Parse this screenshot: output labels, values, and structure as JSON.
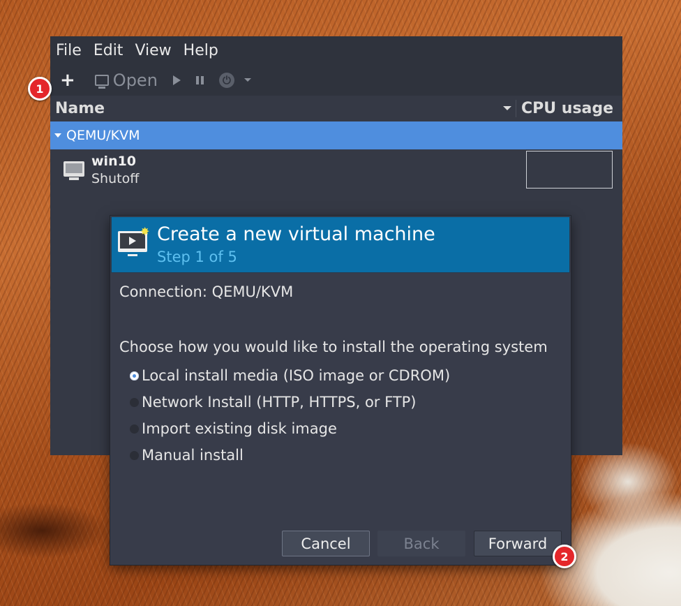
{
  "menubar": {
    "items": [
      "File",
      "Edit",
      "View",
      "Help"
    ]
  },
  "toolbar": {
    "new_label": "+",
    "open_label": "Open"
  },
  "columns": {
    "name": "Name",
    "cpu": "CPU usage"
  },
  "vm_list": {
    "group": "QEMU/KVM",
    "vms": [
      {
        "name": "win10",
        "state": "Shutoff"
      }
    ]
  },
  "dialog": {
    "title": "Create a new virtual machine",
    "step": "Step 1 of 5",
    "connection": "Connection: QEMU/KVM",
    "prompt": "Choose how you would like to install the operating system",
    "options": [
      {
        "label": "Local install media (ISO image or CDROM)",
        "selected": true
      },
      {
        "label": "Network Install (HTTP, HTTPS, or FTP)",
        "selected": false
      },
      {
        "label": "Import existing disk image",
        "selected": false
      },
      {
        "label": "Manual install",
        "selected": false
      }
    ],
    "buttons": {
      "cancel": "Cancel",
      "back": "Back",
      "forward": "Forward"
    }
  },
  "badges": [
    "1",
    "2"
  ],
  "colors": {
    "selection": "#4f8ede",
    "header": "#0a6ea6",
    "badge": "#e4262a"
  }
}
